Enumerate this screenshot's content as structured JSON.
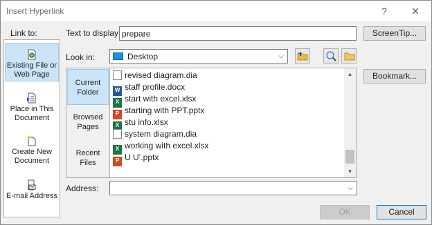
{
  "window": {
    "title": "Insert Hyperlink",
    "help_glyph": "?",
    "close_glyph": "✕"
  },
  "link_to": {
    "label": "Link to:",
    "items": [
      {
        "label": "Existing File or Web Page",
        "icon": "existing-file-icon"
      },
      {
        "label": "Place in This Document",
        "icon": "place-in-document-icon"
      },
      {
        "label": "Create New Document",
        "icon": "new-document-icon"
      },
      {
        "label": "E-mail Address",
        "icon": "email-icon"
      }
    ]
  },
  "text_to_display": {
    "label": "Text to display:",
    "value": "prepare"
  },
  "screentip_button": "ScreenTip...",
  "look_in": {
    "label": "Look in:",
    "value": "Desktop"
  },
  "sub_nav": {
    "current": "Current Folder",
    "browsed": "Browsed Pages",
    "recent": "Recent Files"
  },
  "files": [
    {
      "name": "revised diagram.dia",
      "type": "dia"
    },
    {
      "name": "staff profile.docx",
      "type": "word"
    },
    {
      "name": "start with excel.xlsx",
      "type": "excel"
    },
    {
      "name": "starting with PPT.pptx",
      "type": "ppt"
    },
    {
      "name": "stu info.xlsx",
      "type": "excel"
    },
    {
      "name": "system diagram.dia",
      "type": "dia"
    },
    {
      "name": "working with excel.xlsx",
      "type": "excel"
    },
    {
      "name": "U Uʼ.pptx",
      "type": "ppt"
    }
  ],
  "bookmark_button": "Bookmark...",
  "address": {
    "label": "Address:",
    "value": ""
  },
  "ok_button": "OK",
  "cancel_button": "Cancel",
  "colors": {
    "selection": "#cce4f7",
    "word": "#2b579a",
    "excel": "#217346",
    "ppt": "#d24726",
    "folder": "#e8b84a"
  }
}
